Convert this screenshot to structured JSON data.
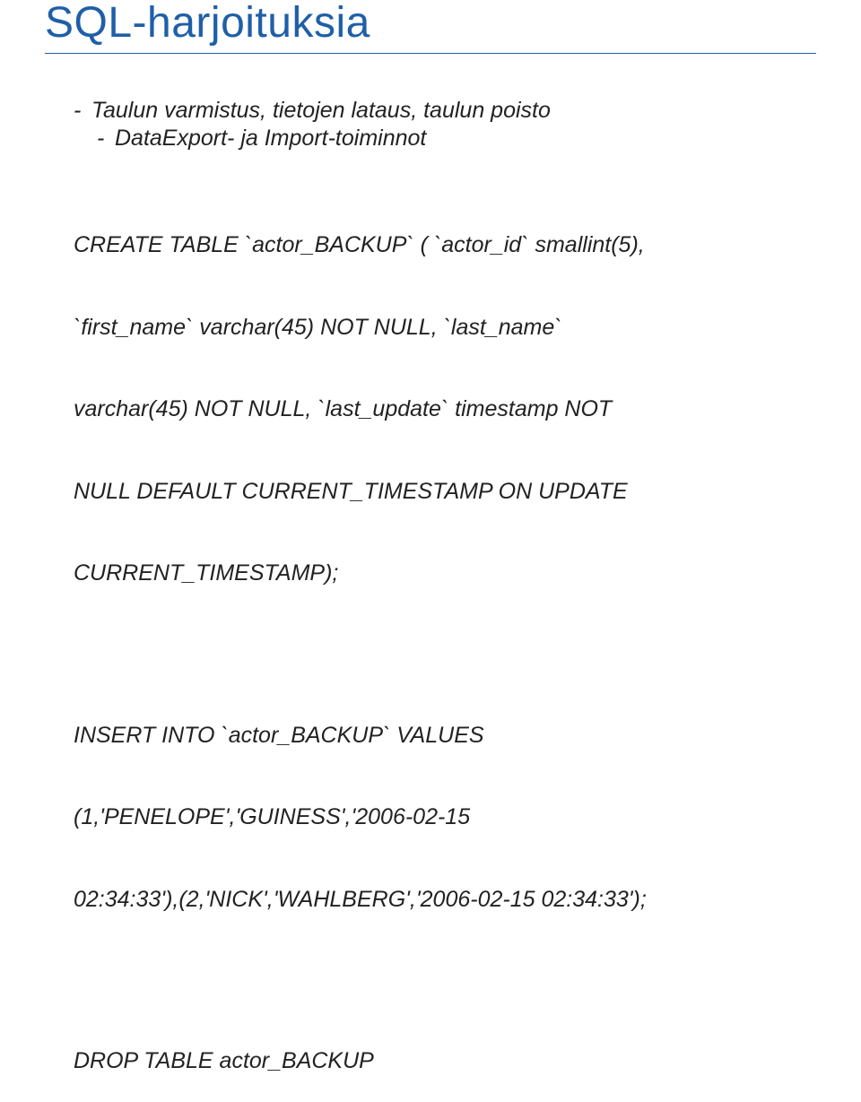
{
  "title": "SQL-harjoituksia",
  "bullets": {
    "b1": "Taulun varmistus, tietojen lataus, taulun poisto",
    "b2": "DataExport- ja Import-toiminnot"
  },
  "sql": {
    "create1": "CREATE TABLE `actor_BACKUP` ( `actor_id` smallint(5),",
    "create2": "`first_name` varchar(45) NOT NULL, `last_name`",
    "create3": "varchar(45) NOT NULL, `last_update` timestamp NOT",
    "create4": "NULL DEFAULT CURRENT_TIMESTAMP ON UPDATE",
    "create5": "CURRENT_TIMESTAMP);",
    "insert1": "INSERT INTO `actor_BACKUP` VALUES",
    "insert2": "(1,'PENELOPE','GUINESS','2006-02-15",
    "insert3": "02:34:33'),(2,'NICK','WAHLBERG','2006-02-15 02:34:33');",
    "drop": "DROP TABLE actor_BACKUP"
  }
}
